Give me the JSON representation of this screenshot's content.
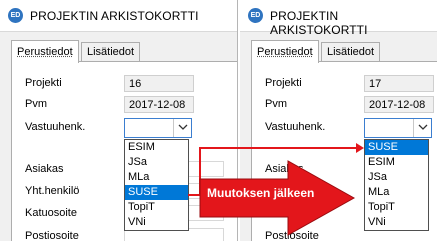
{
  "window": {
    "icon_text": "ED",
    "title": "PROJEKTIN ARKISTOKORTTI"
  },
  "tabs": [
    "Perustiedot",
    "Lisätiedot"
  ],
  "labels": {
    "projekti": "Projekti",
    "pvm": "Pvm",
    "vastuuhenk": "Vastuuhenk.",
    "asiakas": "Asiakas",
    "yht_henkilo": "Yht.henkilö",
    "katuosoite": "Katuosoite",
    "postiosoite": "Postiosoite"
  },
  "before": {
    "projekti_value": "16",
    "pvm_value": "2017-12-08",
    "vastuuhenk_value": "",
    "dropdown_items": [
      "ESIM",
      "JSa",
      "MLa",
      "SUSE",
      "TopiT",
      "VNi"
    ],
    "selected_item": "SUSE"
  },
  "after": {
    "projekti_value": "17",
    "pvm_value": "2017-12-08",
    "vastuuhenk_value": "",
    "dropdown_items": [
      "SUSE",
      "ESIM",
      "JSa",
      "MLa",
      "SUSE",
      "TopiT",
      "VNi"
    ],
    "selected_item": "SUSE"
  },
  "annotation": {
    "text": "Muutoksen jälkeen",
    "color": "#e3161b"
  },
  "icons": {
    "combo_arrow": "chevron-down-icon",
    "app": "app-logo-icon"
  }
}
